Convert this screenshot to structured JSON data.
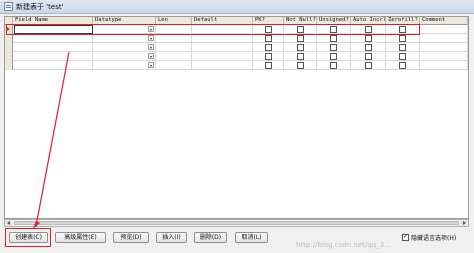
{
  "window": {
    "title": "新建表于 'test'"
  },
  "columns": [
    {
      "key": "field_name",
      "label": "Field Name"
    },
    {
      "key": "datatype",
      "label": "Datatype"
    },
    {
      "key": "len",
      "label": "Len"
    },
    {
      "key": "default",
      "label": "Default"
    },
    {
      "key": "pk",
      "label": "PK?"
    },
    {
      "key": "not_null",
      "label": "Not Null?"
    },
    {
      "key": "unsigned",
      "label": "Unsigned?"
    },
    {
      "key": "auto_incr",
      "label": "Auto Incr?"
    },
    {
      "key": "zerofill",
      "label": "Zerofill?"
    },
    {
      "key": "comment",
      "label": "Comment"
    }
  ],
  "rows": [
    {
      "field_name": "",
      "datatype": "",
      "len": "",
      "default": "",
      "comment": "",
      "current": true
    },
    {
      "field_name": "",
      "datatype": "",
      "len": "",
      "default": "",
      "comment": "",
      "current": false
    },
    {
      "field_name": "",
      "datatype": "",
      "len": "",
      "default": "",
      "comment": "",
      "current": false
    },
    {
      "field_name": "",
      "datatype": "",
      "len": "",
      "default": "",
      "comment": "",
      "current": false
    },
    {
      "field_name": "",
      "datatype": "",
      "len": "",
      "default": "",
      "comment": "",
      "current": false
    }
  ],
  "buttons": {
    "create": "创建表(C)",
    "advanced": "高级属性(E)",
    "preview": "预览(D)",
    "insert": "插入(I)",
    "delete": "删除(D)",
    "cancel": "取消(L)"
  },
  "hide_lang_options": {
    "label": "隐藏语言选项(H)",
    "checked": true
  },
  "watermark": "http://blog.csdn.net/qq_3...",
  "annotation": {
    "color": "#e21b2d"
  }
}
